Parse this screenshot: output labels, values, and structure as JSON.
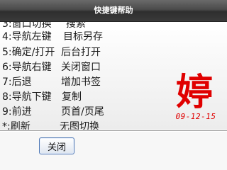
{
  "window": {
    "title": "快捷键帮助"
  },
  "shortcuts": [
    {
      "key": "3:窗口切换",
      "action": "搜索"
    },
    {
      "key": "4:导航左键",
      "action": "目标另存"
    },
    {
      "key": "5:确定/打开",
      "action": "后台打开"
    },
    {
      "key": "6:导航右键",
      "action": "关闭窗口"
    },
    {
      "key": "7:后退",
      "action": "增加书签"
    },
    {
      "key": "8:导航下键",
      "action": "复制"
    },
    {
      "key": "9:前进",
      "action": "页首/页尾"
    },
    {
      "key": "*:刷新",
      "action": "无图切换"
    }
  ],
  "footer": {
    "close_label": "关闭"
  },
  "stamp": {
    "character": "婷",
    "date": "09-12-15",
    "color": "#e00000"
  }
}
